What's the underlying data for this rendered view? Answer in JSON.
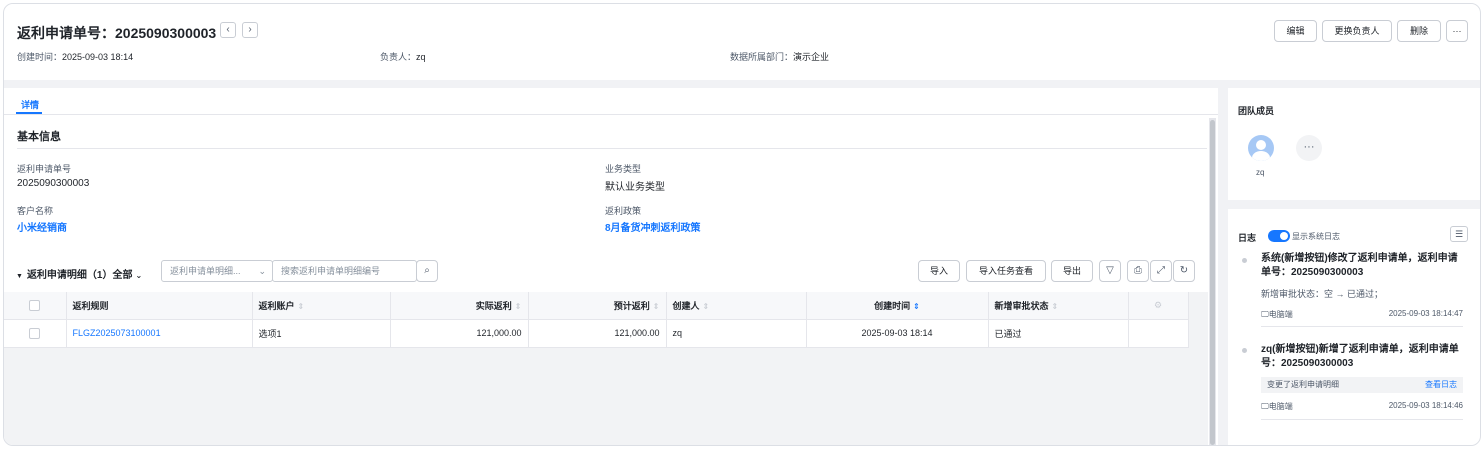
{
  "header": {
    "title": "返利申请单号：2025090300003",
    "prev_icon": "‹",
    "next_icon": "›",
    "created_label": "创建时间：",
    "created_value": "2025-09-03 18:14",
    "owner_label": "负责人：",
    "owner_value": "zq",
    "dept_label": "数据所属部门：",
    "dept_value": "演示企业",
    "buttons": {
      "edit": "编辑",
      "change_owner": "更换负责人",
      "delete": "删除",
      "more": "···"
    }
  },
  "tabs": [
    {
      "label": "详情"
    }
  ],
  "basic_info": {
    "title": "基本信息",
    "fields": [
      {
        "label": "返利申请单号",
        "value": "2025090300003"
      },
      {
        "label": "业务类型",
        "value": "默认业务类型"
      },
      {
        "label": "客户名称",
        "value": "小米经销商"
      },
      {
        "label": "返利政策",
        "value": "8月备货冲刺返利政策"
      }
    ]
  },
  "detail": {
    "title": "返利申请明细（1）全部",
    "field_select": "返利申请单明细...",
    "search_placeholder": "搜索返利申请单明细编号",
    "buttons": {
      "import": "导入",
      "import_tasks": "导入任务查看",
      "export": "导出"
    },
    "columns": [
      "返利规则",
      "返利账户",
      "实际返利",
      "预计返利",
      "创建人",
      "创建时间",
      "新增审批状态"
    ],
    "rows": [
      {
        "rule": "FLGZ2025073100001",
        "account": "选项1",
        "actual": "121,000.00",
        "estimated": "121,000.00",
        "creator": "zq",
        "created": "2025-09-03 18:14",
        "status": "已通过"
      }
    ]
  },
  "team": {
    "title": "团队成员",
    "members": [
      {
        "name": "zq"
      }
    ],
    "more": "···"
  },
  "log": {
    "title": "日志",
    "toggle_label": "显示系统日志",
    "entries": [
      {
        "title": "系统(新增按钮)修改了返利申请单，返利申请单号：2025090300003",
        "detail": "新增审批状态：空 → 已通过；",
        "source": "电脑端",
        "time": "2025-09-03 18:14:47"
      },
      {
        "title": "zq(新增按钮)新增了返利申请单，返利申请单号：2025090300003",
        "detail": "变更了返利申请明细",
        "link": "查看日志",
        "source": "电脑端",
        "time": "2025-09-03 18:14:46"
      }
    ]
  },
  "colors": {
    "accent": "#1677ff",
    "background": "#f1f2f5",
    "border": "#e5e6eb"
  }
}
